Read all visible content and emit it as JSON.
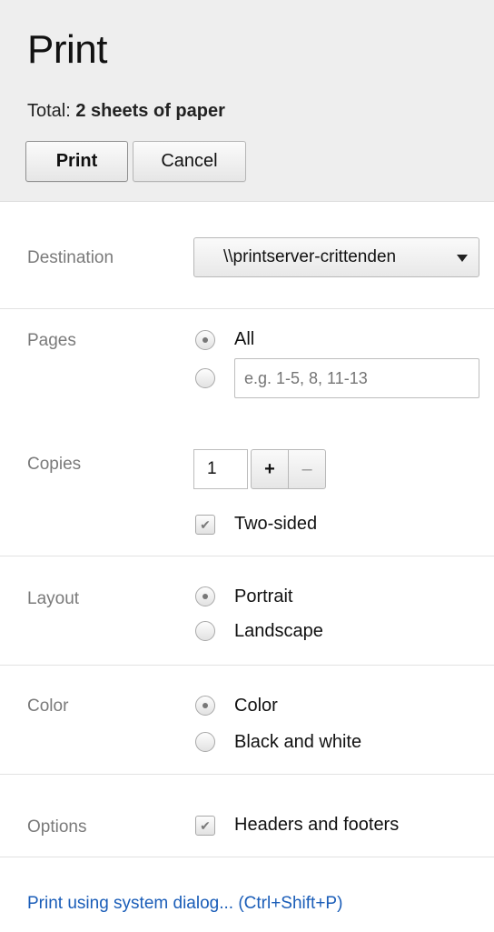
{
  "header": {
    "title": "Print",
    "total_prefix": "Total:",
    "total_value": "2 sheets of paper",
    "print_label": "Print",
    "cancel_label": "Cancel"
  },
  "destination": {
    "label": "Destination",
    "value": "\\\\printserver-crittenden"
  },
  "pages": {
    "label": "Pages",
    "all_label": "All",
    "range_placeholder": "e.g. 1-5, 8, 11-13",
    "selected": "All"
  },
  "copies": {
    "label": "Copies",
    "value": "1",
    "plus_label": "+",
    "minus_label": "–",
    "two_sided_label": "Two-sided",
    "two_sided_checked": true
  },
  "layout": {
    "label": "Layout",
    "portrait_label": "Portrait",
    "landscape_label": "Landscape",
    "selected": "Portrait"
  },
  "color": {
    "label": "Color",
    "color_label": "Color",
    "bw_label": "Black and white",
    "selected": "Color"
  },
  "options": {
    "label": "Options",
    "headers_footers_label": "Headers and footers",
    "headers_footers_checked": true
  },
  "footer": {
    "system_dialog_link": "Print using system dialog... (Ctrl+Shift+P)"
  }
}
